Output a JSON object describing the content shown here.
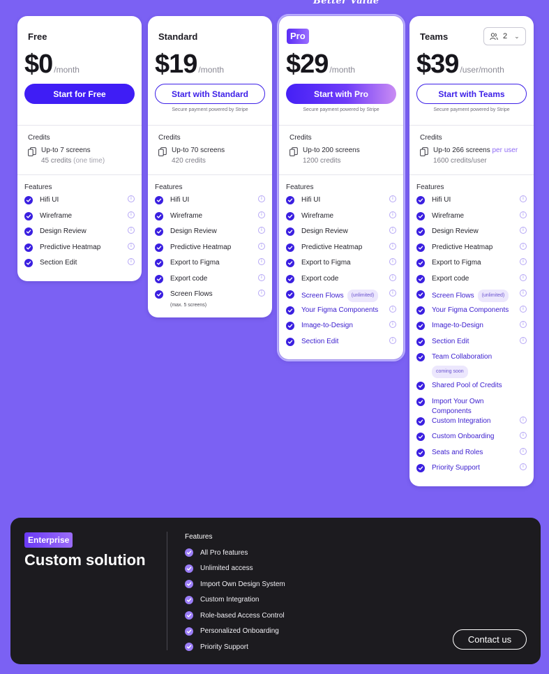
{
  "tagline": "Better Value",
  "plans": [
    {
      "name": "Free",
      "price": "$0",
      "per": "/month",
      "cta": "Start for Free",
      "secure": "",
      "credits_title": "Credits",
      "credits_main": "Up-to 7 screens",
      "credits_highlight": "",
      "credits_sub": "45 credits",
      "credits_sub_note": "(one time)",
      "features_title": "Features",
      "features": [
        {
          "label": "Hifi UI",
          "info": true
        },
        {
          "label": "Wireframe",
          "info": true
        },
        {
          "label": "Design Review",
          "info": true
        },
        {
          "label": "Predictive Heatmap",
          "info": true
        },
        {
          "label": "Section Edit",
          "info": true
        }
      ]
    },
    {
      "name": "Standard",
      "price": "$19",
      "per": "/month",
      "cta": "Start with Standard",
      "secure": "Secure payment powered by Stripe",
      "credits_title": "Credits",
      "credits_main": "Up-to 70 screens",
      "credits_highlight": "",
      "credits_sub": "420 credits",
      "credits_sub_note": "",
      "features_title": "Features",
      "features": [
        {
          "label": "Hifi UI",
          "info": true
        },
        {
          "label": "Wireframe",
          "info": true
        },
        {
          "label": "Design Review",
          "info": true
        },
        {
          "label": "Predictive Heatmap",
          "info": true
        },
        {
          "label": "Export to Figma",
          "info": true
        },
        {
          "label": "Export code",
          "info": true
        },
        {
          "label": "Screen Flows",
          "info": true,
          "note": "(max. 5 screens)"
        }
      ]
    },
    {
      "name": "Pro",
      "price": "$29",
      "per": "/month",
      "cta": "Start with Pro",
      "secure": "Secure payment powered by Stripe",
      "credits_title": "Credits",
      "credits_main": "Up-to 200 screens",
      "credits_highlight": "",
      "credits_sub": "1200 credits",
      "credits_sub_note": "",
      "features_title": "Features",
      "features": [
        {
          "label": "Hifi UI",
          "info": true
        },
        {
          "label": "Wireframe",
          "info": true
        },
        {
          "label": "Design Review",
          "info": true
        },
        {
          "label": "Predictive Heatmap",
          "info": true
        },
        {
          "label": "Export to Figma",
          "info": true
        },
        {
          "label": "Export code",
          "info": true
        },
        {
          "label": "Screen Flows",
          "info": true,
          "purple": true,
          "pill": "(unlimited)"
        },
        {
          "label": "Your Figma Components",
          "info": true,
          "purple": true
        },
        {
          "label": "Image-to-Design",
          "info": true,
          "purple": true
        },
        {
          "label": "Section Edit",
          "info": true,
          "purple": true
        }
      ]
    },
    {
      "name": "Teams",
      "price": "$39",
      "per": "/user/month",
      "cta": "Start with Teams",
      "secure": "Secure payment powered by Stripe",
      "seat_count": "2",
      "credits_title": "Credits",
      "credits_main": "Up-to 266 screens",
      "credits_highlight": "per user",
      "credits_sub": "1600 credits/user",
      "credits_sub_note": "",
      "features_title": "Features",
      "features": [
        {
          "label": "Hifi UI",
          "info": true
        },
        {
          "label": "Wireframe",
          "info": true
        },
        {
          "label": "Design Review",
          "info": true
        },
        {
          "label": "Predictive Heatmap",
          "info": true
        },
        {
          "label": "Export to Figma",
          "info": true
        },
        {
          "label": "Export code",
          "info": true
        },
        {
          "label": "Screen Flows",
          "info": true,
          "purple": true,
          "pill": "(unlimited)"
        },
        {
          "label": "Your Figma Components",
          "info": true,
          "purple": true
        },
        {
          "label": "Image-to-Design",
          "info": true,
          "purple": true
        },
        {
          "label": "Section Edit",
          "info": true,
          "purple": true
        },
        {
          "label": "Team Collaboration",
          "info": false,
          "purple": true,
          "pill_block": "coming soon"
        },
        {
          "label": "Shared Pool of Credits",
          "info": false,
          "purple": true
        },
        {
          "label": "Import Your Own Components",
          "info": false,
          "purple": true
        },
        {
          "label": "Custom Integration",
          "info": true,
          "purple": true
        },
        {
          "label": "Custom Onboarding",
          "info": true,
          "purple": true
        },
        {
          "label": "Seats and Roles",
          "info": true,
          "purple": true
        },
        {
          "label": "Priority Support",
          "info": true,
          "purple": true
        }
      ]
    }
  ],
  "enterprise": {
    "badge": "Enterprise",
    "title": "Custom solution",
    "features_title": "Features",
    "features": [
      "All Pro features",
      "Unlimited access",
      "Import Own Design System",
      "Custom Integration",
      "Role-based Access Control",
      "Personalized Onboarding",
      "Priority Support"
    ],
    "cta": "Contact us"
  },
  "colors": {
    "background": "#7b61f3",
    "accent": "#3f1df5",
    "check": "#3a1fe0",
    "enterprise_bg": "#1c1b1f"
  }
}
